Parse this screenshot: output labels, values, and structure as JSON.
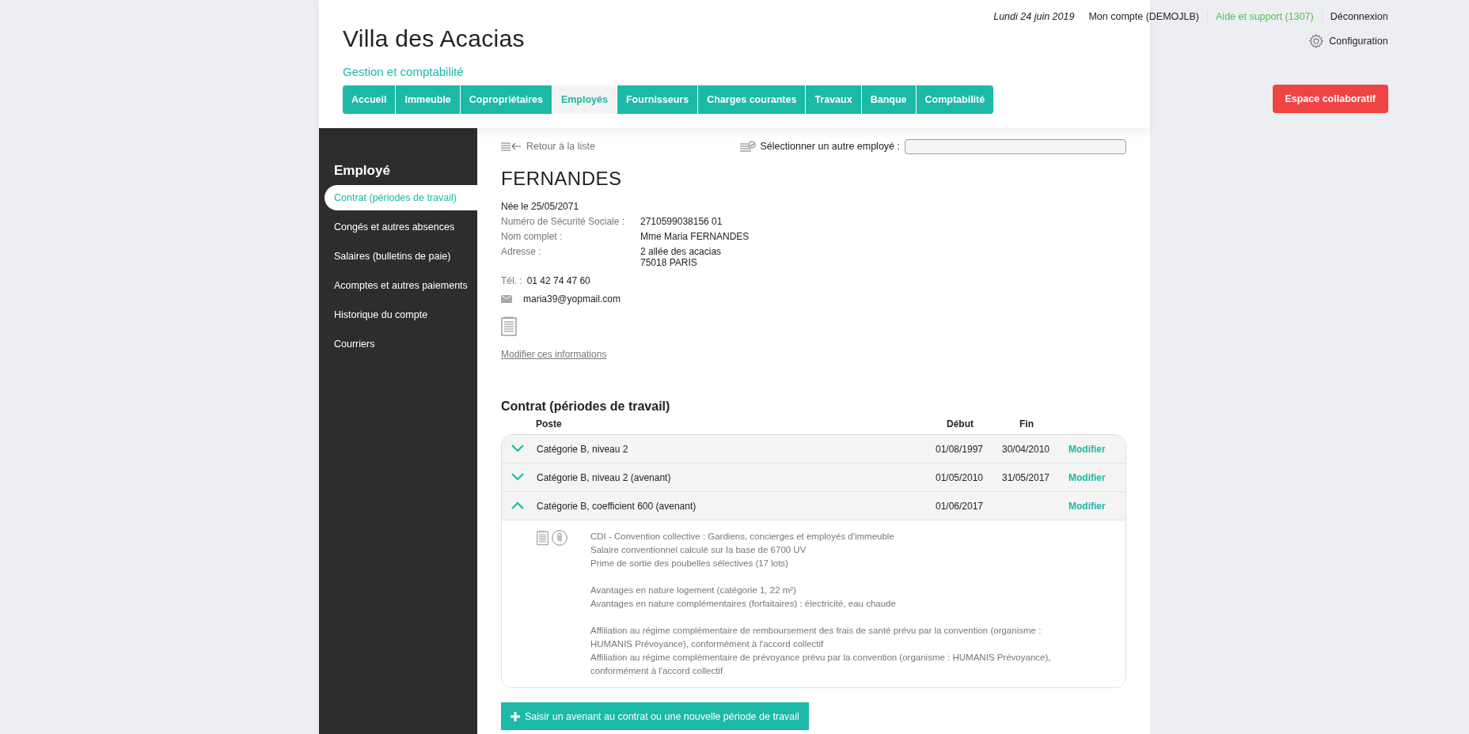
{
  "header": {
    "title": "Villa des Acacias",
    "subtitle": "Gestion et comptabilité",
    "date": "Lundi 24 juin 2019",
    "account": "Mon compte (DEMOJLB)",
    "support": "Aide et support (1307)",
    "logout": "Déconnexion",
    "config": "Configuration",
    "tabs": [
      {
        "label": "Accueil",
        "selected": false
      },
      {
        "label": "Immeuble",
        "selected": false
      },
      {
        "label": "Copropriétaires",
        "selected": false
      },
      {
        "label": "Employés",
        "selected": true
      },
      {
        "label": "Fournisseurs",
        "selected": false
      },
      {
        "label": "Charges courantes",
        "selected": false
      },
      {
        "label": "Travaux",
        "selected": false
      },
      {
        "label": "Banque",
        "selected": false
      },
      {
        "label": "Comptabilité",
        "selected": false
      }
    ],
    "collab_button": "Espace collaboratif"
  },
  "sidebar": {
    "title": "Employé",
    "items": [
      {
        "label": "Contrat (périodes de travail)",
        "selected": true
      },
      {
        "label": "Congés et autres absences",
        "selected": false
      },
      {
        "label": "Salaires (bulletins de paie)",
        "selected": false
      },
      {
        "label": "Acomptes et autres paiements",
        "selected": false
      },
      {
        "label": "Historique du compte",
        "selected": false
      },
      {
        "label": "Courriers",
        "selected": false
      }
    ]
  },
  "employee": {
    "back_link": "Retour à la liste",
    "select_label": "Sélectionner un autre employé :",
    "name": "FERNANDES",
    "birth": "Née le 25/05/2071",
    "fields": [
      {
        "label": "Numéro de Sécurité Sociale :",
        "value": [
          "2710599038156 01"
        ]
      },
      {
        "label": "Nom complet :",
        "value": [
          "Mme Maria FERNANDES"
        ]
      },
      {
        "label": "Adresse :",
        "value": [
          "2 allée des acacias",
          "75018 PARIS"
        ]
      }
    ],
    "phone_label": "Tél. :",
    "phone": "01 42 74 47 60",
    "email": "maria39@yopmail.com",
    "edit_link": "Modifier ces informations"
  },
  "contracts": {
    "title": "Contrat (périodes de travail)",
    "columns": [
      "Poste",
      "Début",
      "Fin"
    ],
    "rows": [
      {
        "poste": "Catégorie B, niveau 2",
        "debut": "01/08/1997",
        "fin": "30/04/2010",
        "action": "Modifier",
        "expanded": false
      },
      {
        "poste": "Catégorie B, niveau 2 (avenant)",
        "debut": "01/05/2010",
        "fin": "31/05/2017",
        "action": "Modifier",
        "expanded": false
      },
      {
        "poste": "Catégorie B, coefficient 600 (avenant)",
        "debut": "01/06/2017",
        "action": "Modifier",
        "expanded": true,
        "details": [
          [
            "CDI - Convention collective : Gardiens, concierges et employés d'immeuble",
            "Salaire conventionnel calculé sur la base de 6700 UV",
            "Prime de sortie des poubelles sélectives (17 lots)"
          ],
          [
            "Avantages en nature logement (catégorie 1, 22 m²)",
            "Avantages en nature complémentaires (forfaitaires) : électricité, eau chaude"
          ],
          [
            "Affiliation au régime complémentaire de remboursement des frais de santé prévu par la convention (organisme : HUMANIS Prévoyance), conformément à l'accord collectif",
            "Affiliation au régime complémentaire de prévoyance prévu par la convention (organisme : HUMANIS Prévoyance), conformément à l'accord collectif"
          ]
        ]
      }
    ],
    "add_button": "Saisir un avenant au contrat ou une nouvelle période de travail"
  }
}
